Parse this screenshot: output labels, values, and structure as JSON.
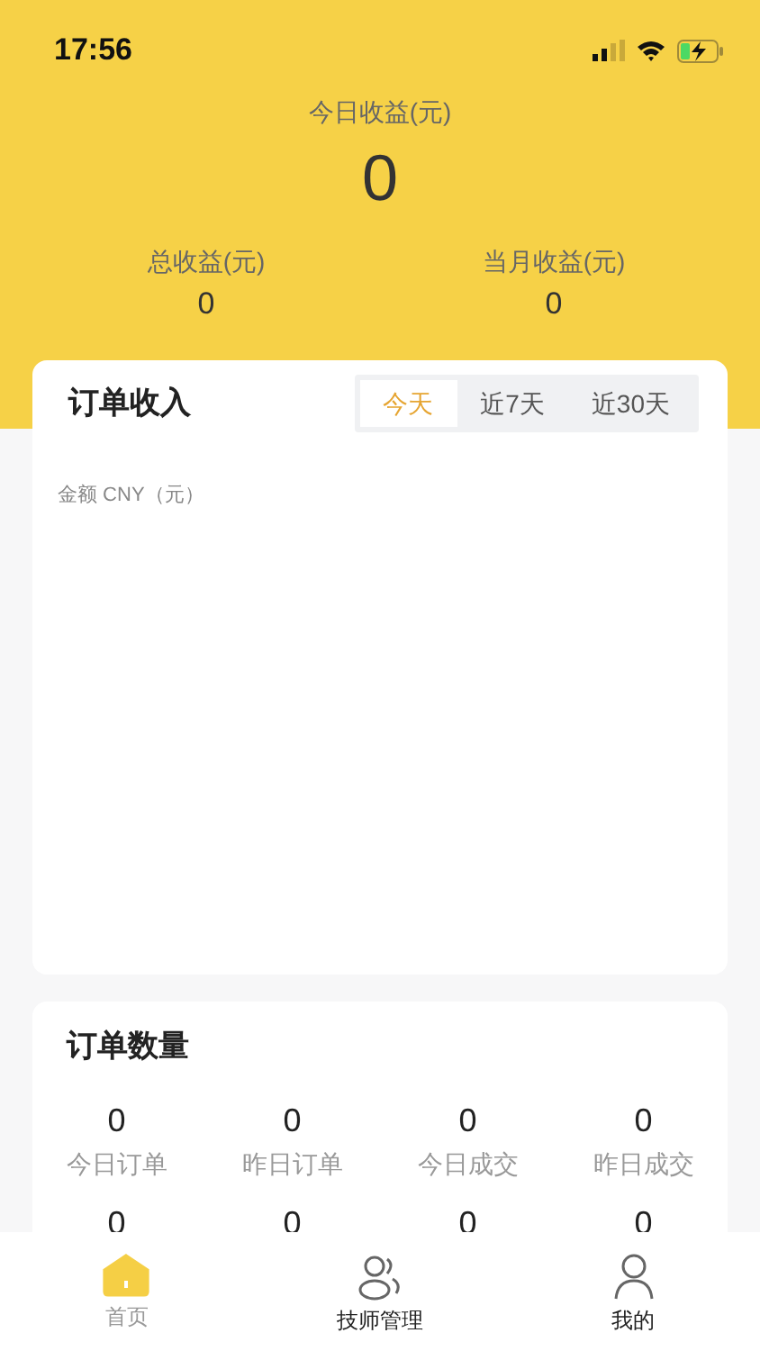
{
  "status_bar": {
    "time": "17:56"
  },
  "header": {
    "today_label": "今日收益(元)",
    "today_value": "0",
    "stats": [
      {
        "label": "总收益(元)",
        "value": "0"
      },
      {
        "label": "当月收益(元)",
        "value": "0"
      }
    ]
  },
  "income_card": {
    "title": "订单收入",
    "tabs": [
      {
        "label": "今天",
        "selected": true
      },
      {
        "label": "近7天",
        "selected": false
      },
      {
        "label": "近30天",
        "selected": false
      }
    ],
    "axis_label": "金额 CNY（元）"
  },
  "order_card": {
    "title": "订单数量",
    "stats": [
      {
        "value": "0",
        "label": "今日订单"
      },
      {
        "value": "0",
        "label": "昨日订单"
      },
      {
        "value": "0",
        "label": "今日成交"
      },
      {
        "value": "0",
        "label": "昨日成交"
      }
    ],
    "second_row_values": [
      "0",
      "0",
      "0",
      "0"
    ]
  },
  "tab_bar": [
    {
      "kind": "home",
      "label": "首页",
      "selected": true
    },
    {
      "kind": "people",
      "label": "技师管理",
      "selected": false
    },
    {
      "kind": "person",
      "label": "我的",
      "selected": false
    }
  ]
}
